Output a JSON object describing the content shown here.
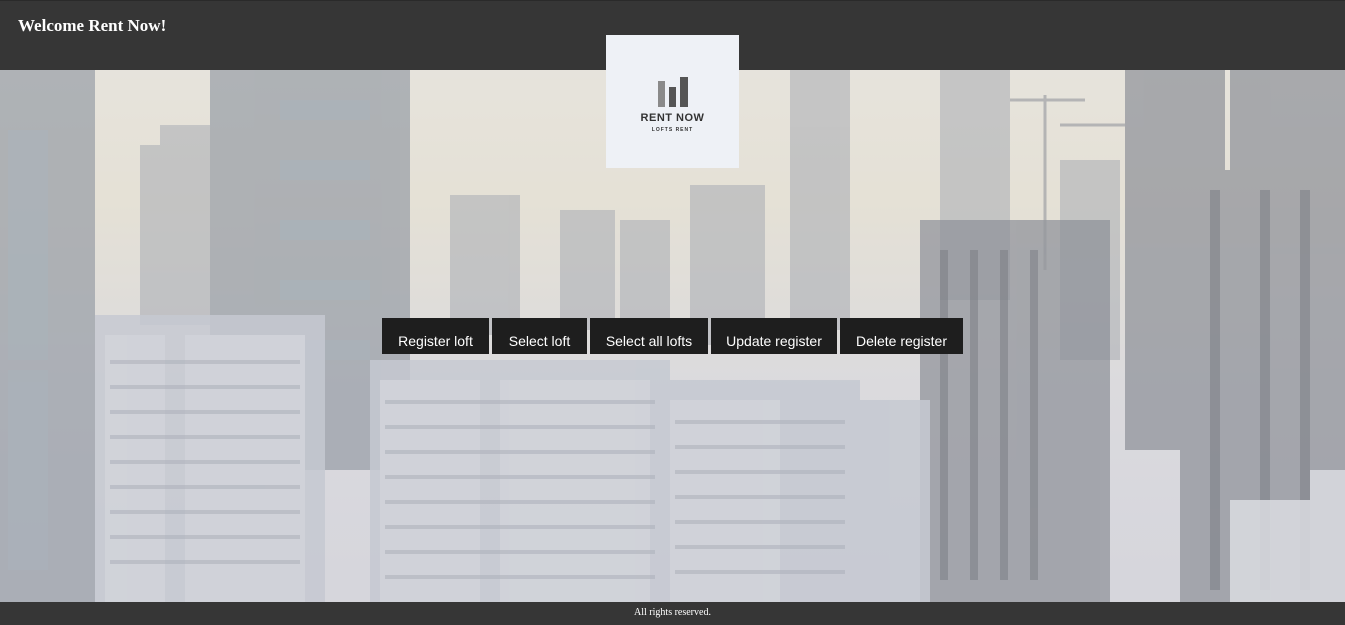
{
  "header": {
    "title": "Welcome Rent Now!"
  },
  "logo": {
    "name": "RENT NOW",
    "tagline": "LOFTS RENT",
    "icon": "bar-building-logo-icon"
  },
  "nav": {
    "buttons": [
      {
        "label": "Register loft"
      },
      {
        "label": "Select loft"
      },
      {
        "label": "Select all lofts"
      },
      {
        "label": "Update register"
      },
      {
        "label": "Delete register"
      }
    ]
  },
  "footer": {
    "text": "All rights reserved."
  },
  "colors": {
    "header_bg": "#363636",
    "button_bg": "#1e1e1e",
    "logo_bg": "#eef1f6"
  }
}
